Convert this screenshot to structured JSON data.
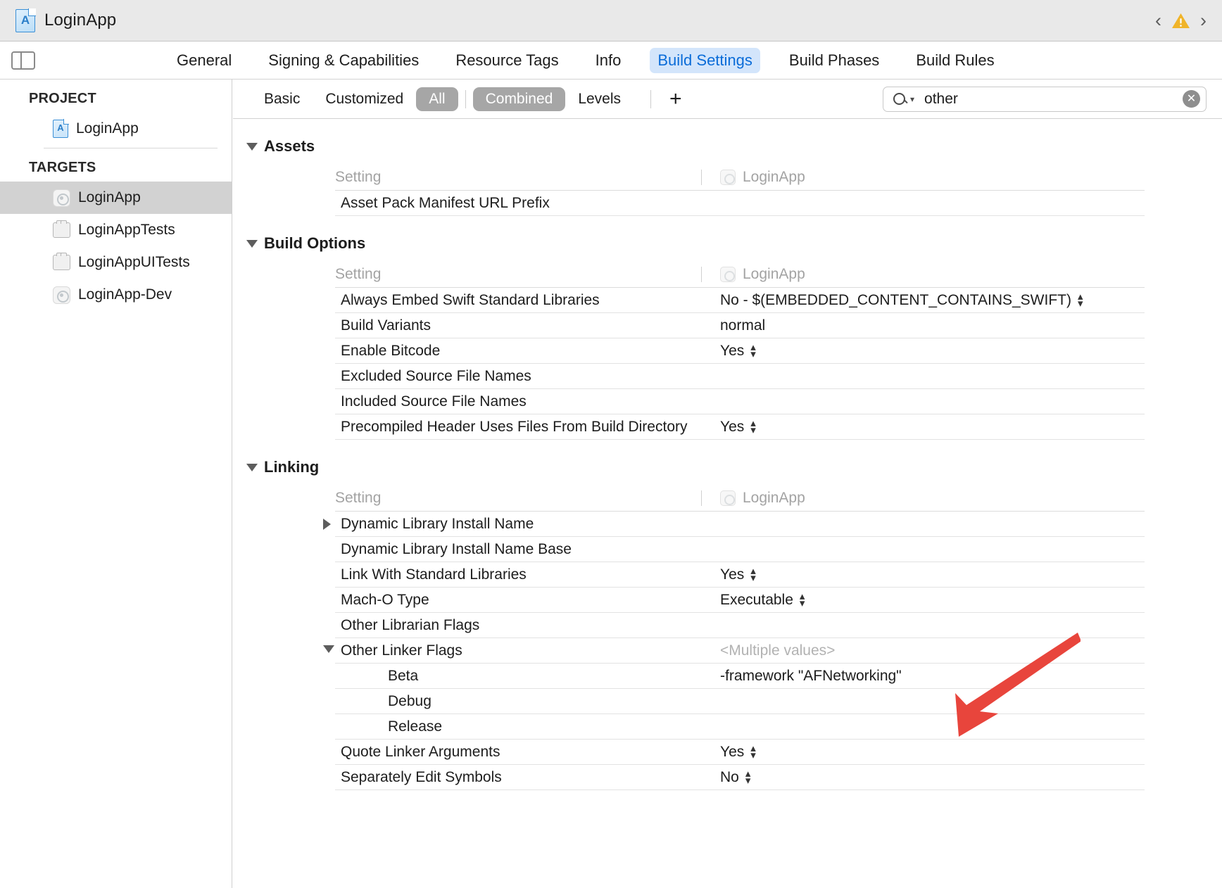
{
  "window": {
    "title": "LoginApp",
    "project_icon": "xcode-project-icon",
    "nav_back_icon": "chevron-left-icon",
    "nav_forward_icon": "chevron-right-icon",
    "warning_icon": "warning-triangle-icon",
    "warning_color": "#f0b429"
  },
  "toolbar": {
    "sidebar_toggle_icon": "sidebar-toggle-icon",
    "tabs": [
      {
        "label": "General",
        "active": false
      },
      {
        "label": "Signing & Capabilities",
        "active": false
      },
      {
        "label": "Resource Tags",
        "active": false
      },
      {
        "label": "Info",
        "active": false
      },
      {
        "label": "Build Settings",
        "active": true
      },
      {
        "label": "Build Phases",
        "active": false
      },
      {
        "label": "Build Rules",
        "active": false
      }
    ],
    "active_tab_color": "#0a6cd8",
    "active_tab_bg": "#d3e5fb"
  },
  "filterbar": {
    "scope_options": [
      {
        "label": "Basic",
        "selected": false
      },
      {
        "label": "Customized",
        "selected": false
      },
      {
        "label": "All",
        "selected": true
      }
    ],
    "view_options": [
      {
        "label": "Combined",
        "selected": true
      },
      {
        "label": "Levels",
        "selected": false
      }
    ],
    "add_button_label": "+",
    "add_button_icon": "plus-icon",
    "selected_pill_bg": "#a6a6a6",
    "search": {
      "icon": "search-icon",
      "dropdown_icon": "chevron-down-icon",
      "value": "other",
      "placeholder": "",
      "clear_icon": "clear-circle-icon"
    }
  },
  "sidebar": {
    "project_header": "PROJECT",
    "project_items": [
      {
        "label": "LoginApp",
        "icon": "xcode-project-icon"
      }
    ],
    "targets_header": "TARGETS",
    "target_items": [
      {
        "label": "LoginApp",
        "icon": "app-target-icon",
        "selected": true
      },
      {
        "label": "LoginAppTests",
        "icon": "test-bundle-icon",
        "selected": false
      },
      {
        "label": "LoginAppUITests",
        "icon": "test-bundle-icon",
        "selected": false
      },
      {
        "label": "LoginApp-Dev",
        "icon": "app-target-icon",
        "selected": false
      }
    ]
  },
  "columns": {
    "setting": "Setting",
    "target": "LoginApp",
    "target_icon": "app-target-icon"
  },
  "groups": [
    {
      "title": "Assets",
      "expanded": true,
      "rows": [
        {
          "name": "Asset Pack Manifest URL Prefix",
          "value": "",
          "stepper": false,
          "sub": false,
          "disclosure": "none",
          "placeholder": false
        }
      ]
    },
    {
      "title": "Build Options",
      "expanded": true,
      "rows": [
        {
          "name": "Always Embed Swift Standard Libraries",
          "value": "No  -  $(EMBEDDED_CONTENT_CONTAINS_SWIFT)",
          "stepper": true,
          "sub": false,
          "disclosure": "none",
          "placeholder": false
        },
        {
          "name": "Build Variants",
          "value": "normal",
          "stepper": false,
          "sub": false,
          "disclosure": "none",
          "placeholder": false
        },
        {
          "name": "Enable Bitcode",
          "value": "Yes",
          "stepper": true,
          "sub": false,
          "disclosure": "none",
          "placeholder": false
        },
        {
          "name": "Excluded Source File Names",
          "value": "",
          "stepper": false,
          "sub": false,
          "disclosure": "none",
          "placeholder": false
        },
        {
          "name": "Included Source File Names",
          "value": "",
          "stepper": false,
          "sub": false,
          "disclosure": "none",
          "placeholder": false
        },
        {
          "name": "Precompiled Header Uses Files From Build Directory",
          "value": "Yes",
          "stepper": true,
          "sub": false,
          "disclosure": "none",
          "placeholder": false
        }
      ]
    },
    {
      "title": "Linking",
      "expanded": true,
      "rows": [
        {
          "name": "Dynamic Library Install Name",
          "value": "",
          "stepper": false,
          "sub": false,
          "disclosure": "collapsed",
          "placeholder": false
        },
        {
          "name": "Dynamic Library Install Name Base",
          "value": "",
          "stepper": false,
          "sub": false,
          "disclosure": "none",
          "placeholder": false
        },
        {
          "name": "Link With Standard Libraries",
          "value": "Yes",
          "stepper": true,
          "sub": false,
          "disclosure": "none",
          "placeholder": false
        },
        {
          "name": "Mach-O Type",
          "value": "Executable",
          "stepper": true,
          "sub": false,
          "disclosure": "none",
          "placeholder": false
        },
        {
          "name": "Other Librarian Flags",
          "value": "",
          "stepper": false,
          "sub": false,
          "disclosure": "none",
          "placeholder": false
        },
        {
          "name": "Other Linker Flags",
          "value": "<Multiple values>",
          "stepper": false,
          "sub": false,
          "disclosure": "expanded",
          "placeholder": true
        },
        {
          "name": "Beta",
          "value": "-framework \"AFNetworking\"",
          "stepper": false,
          "sub": true,
          "disclosure": "none",
          "placeholder": false
        },
        {
          "name": "Debug",
          "value": "",
          "stepper": false,
          "sub": true,
          "disclosure": "none",
          "placeholder": false
        },
        {
          "name": "Release",
          "value": "",
          "stepper": false,
          "sub": true,
          "disclosure": "none",
          "placeholder": false
        },
        {
          "name": "Quote Linker Arguments",
          "value": "Yes",
          "stepper": true,
          "sub": false,
          "disclosure": "none",
          "placeholder": false
        },
        {
          "name": "Separately Edit Symbols",
          "value": "No",
          "stepper": true,
          "sub": false,
          "disclosure": "none",
          "placeholder": false
        }
      ]
    }
  ],
  "annotation": {
    "icon": "red-arrow-annotation",
    "color": "#e8453c",
    "points_at": "Other Linker Flags"
  }
}
